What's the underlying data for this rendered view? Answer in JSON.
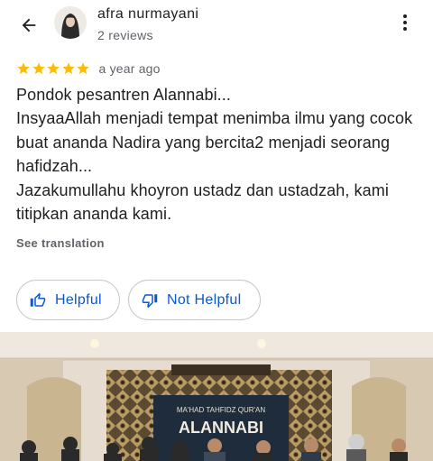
{
  "header": {
    "user_name": "afra nurmayani",
    "reviews_count": "2 reviews",
    "back_icon": "arrow-left-icon",
    "more_icon": "more-vert-icon"
  },
  "review": {
    "stars": 5,
    "max_stars": 5,
    "star_color": "#fbbc04",
    "time": "a year ago",
    "lines": [
      "Pondok pesantren Alannabi...",
      "InsyaaAllah menjadi tempat menimba ilmu yang cocok",
      "buat ananda Nadira yang bercita2 menjadi seorang",
      "hafidzah...",
      "Jazakumullahu khoyron ustadz dan ustadzah, kami",
      "titipkan ananda kami."
    ],
    "see_translation": "See translation"
  },
  "actions": {
    "helpful_label": "Helpful",
    "not_helpful_label": "Not Helpful",
    "accent_color": "#0b57d0"
  },
  "photo": {
    "banner_line1": "MA'HAD TAHFIDZ QUR'AN",
    "banner_line2": "ALANNABI"
  }
}
